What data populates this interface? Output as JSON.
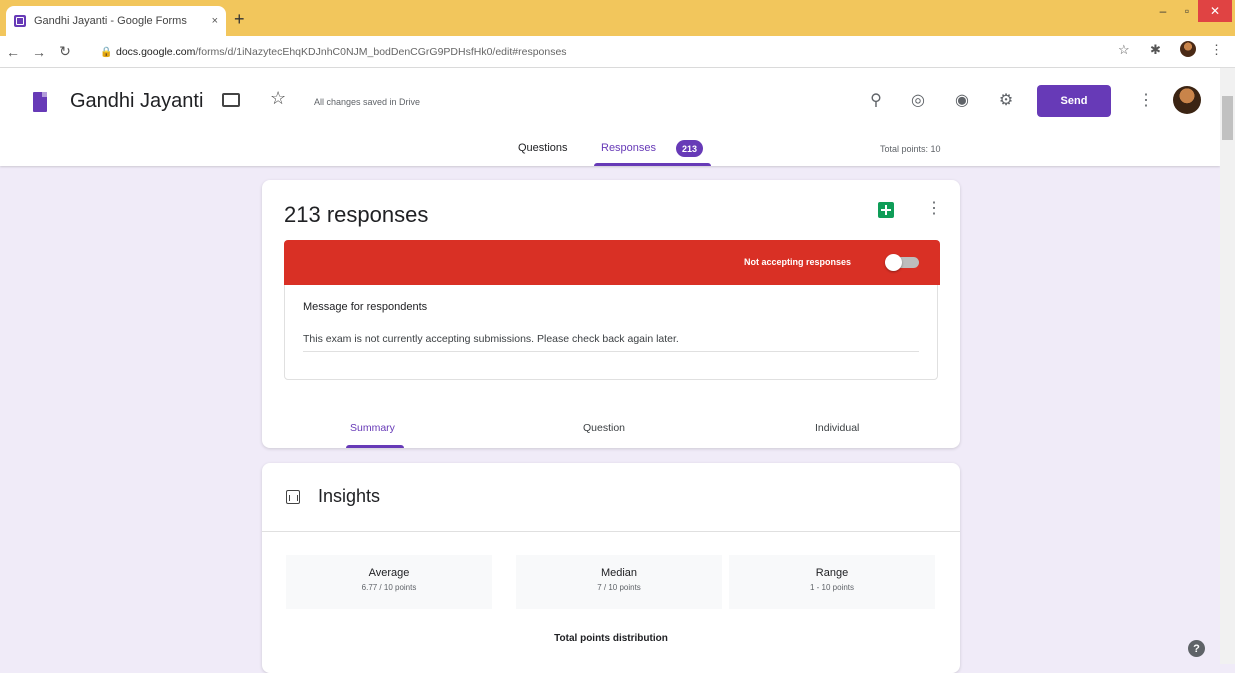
{
  "browser": {
    "tab_title": "Gandhi Jayanti - Google Forms",
    "tab_close": "×",
    "new_tab": "+",
    "url_host": "docs.google.com",
    "url_path": "/forms/d/1iNazytecEhqKDJnhC0NJM_bodDenCGrG9PDHsfHk0/edit#responses",
    "window_minimize": "‒",
    "window_maximize": "▫",
    "window_close": "✕"
  },
  "form": {
    "title": "Gandhi Jayanti",
    "saved_status": "All changes saved in Drive",
    "send_label": "Send",
    "tabs": {
      "questions": "Questions",
      "responses": "Responses",
      "responses_count": "213"
    },
    "total_points": "Total points: 10"
  },
  "responses": {
    "count_label": "213 responses",
    "closed_status": "Not accepting responses",
    "message_label": "Message for respondents",
    "message_text": "This exam is not currently accepting submissions. Please check back again later."
  },
  "subtabs": {
    "summary": "Summary",
    "question": "Question",
    "individual": "Individual"
  },
  "insights": {
    "title": "Insights",
    "stats": {
      "average_label": "Average",
      "average_value": "6.77 / 10 points",
      "median_label": "Median",
      "median_value": "7 / 10 points",
      "range_label": "Range",
      "range_value": "1 - 10 points"
    },
    "distribution_title": "Total points distribution"
  },
  "colors": {
    "accent": "#673ab7",
    "banner_red": "#d93025",
    "sheets_green": "#0f9d58",
    "page_bg": "#f0ebf8"
  },
  "icons": [
    "back-icon",
    "forward-icon",
    "reload-icon",
    "lock-icon",
    "star-icon",
    "extensions-icon",
    "folder-icon",
    "addon-icon",
    "palette-icon",
    "preview-icon",
    "settings-icon",
    "more-icon",
    "sheets-icon",
    "insights-icon",
    "help-icon"
  ]
}
